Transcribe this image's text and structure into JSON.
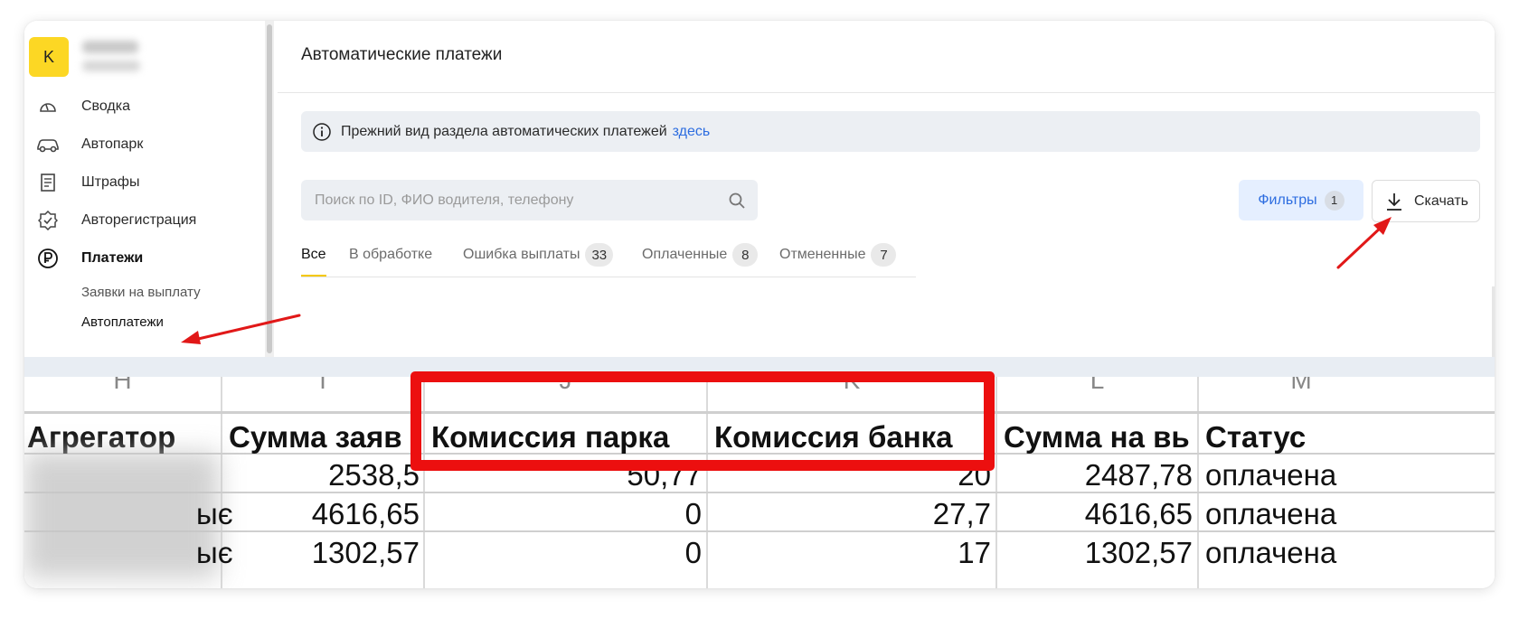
{
  "sidebar": {
    "avatar_letter": "K",
    "nav": [
      {
        "label": "Сводка",
        "icon": "gauge-icon"
      },
      {
        "label": "Автопарк",
        "icon": "car-icon"
      },
      {
        "label": "Штрафы",
        "icon": "document-icon"
      },
      {
        "label": "Авторегистрация",
        "icon": "badge-check-icon"
      },
      {
        "label": "Платежи",
        "icon": "ruble-icon"
      }
    ],
    "sub_items": [
      "Заявки на выплату",
      "Автоплатежи"
    ]
  },
  "main": {
    "title": "Автоматические платежи",
    "notice": {
      "text": "Прежний вид раздела автоматических платежей",
      "link": "здесь"
    },
    "search_placeholder": "Поиск по ID, ФИО водителя, телефону",
    "filters": {
      "label": "Фильтры",
      "count": "1"
    },
    "download_label": "Скачать",
    "tabs": [
      {
        "label": "Все"
      },
      {
        "label": "В обработке"
      },
      {
        "label": "Ошибка выплаты",
        "count": "33"
      },
      {
        "label": "Оплаченные",
        "count": "8"
      },
      {
        "label": "Отмененные",
        "count": "7"
      }
    ]
  },
  "sheet": {
    "column_letters": [
      "H",
      "I",
      "J",
      "K",
      "L",
      "M"
    ],
    "headers": [
      "Агрегатор",
      "Сумма заяв",
      "Комиссия парка",
      "Комиссия банка",
      "Сумма на вь",
      "Статус"
    ],
    "rows": [
      {
        "agg": "",
        "sum": "2538,5",
        "park": "50,77",
        "bank": "20",
        "payout": "2487,78",
        "status": "оплачена"
      },
      {
        "agg": "ыє",
        "sum": "4616,65",
        "park": "0",
        "bank": "27,7",
        "payout": "4616,65",
        "status": "оплачена"
      },
      {
        "agg": "ыє",
        "sum": "1302,57",
        "park": "0",
        "bank": "17",
        "payout": "1302,57",
        "status": "оплачена"
      }
    ]
  },
  "colors": {
    "accent_yellow": "#fcd724",
    "link_blue": "#2d6de0",
    "highlight_red": "#ec0f0f"
  }
}
